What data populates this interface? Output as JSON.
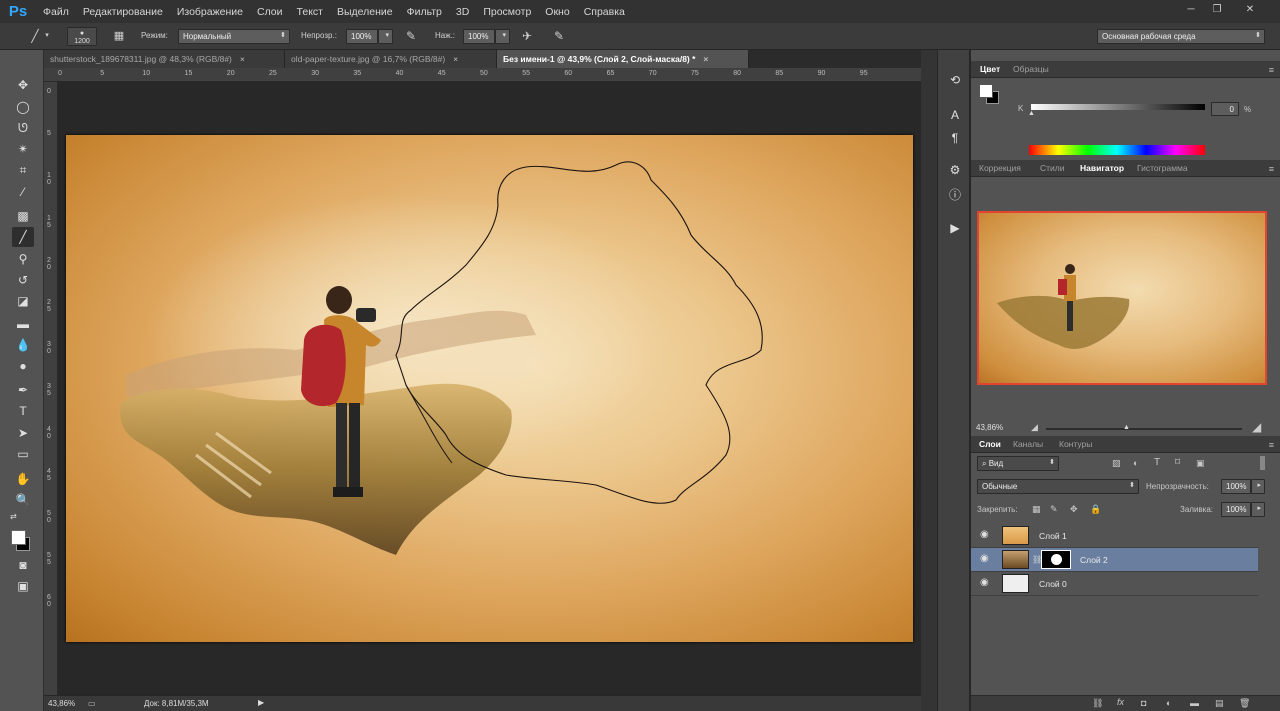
{
  "app": {
    "logo": "Ps"
  },
  "menu": [
    "Файл",
    "Редактирование",
    "Изображение",
    "Слои",
    "Текст",
    "Выделение",
    "Фильтр",
    "3D",
    "Просмотр",
    "Окно",
    "Справка"
  ],
  "options": {
    "brush_size": "1200",
    "mode_label": "Режим:",
    "mode_value": "Нормальный",
    "opacity_label": "Непрозр.:",
    "opacity_value": "100%",
    "pressure_label": "Наж.:",
    "pressure_value": "100%",
    "workspace": "Основная рабочая среда"
  },
  "tabs": [
    {
      "label": "shutterstock_189678311.jpg @ 48,3% (RGB/8#)",
      "close": "×"
    },
    {
      "label": "old-paper-texture.jpg @ 16,7% (RGB/8#)",
      "close": "×"
    },
    {
      "label": "Без имени-1 @ 43,9% (Слой 2, Слой-маска/8) *",
      "close": "×"
    }
  ],
  "ruler": {
    "h": [
      "0",
      "5",
      "10",
      "15",
      "20",
      "25",
      "30",
      "35",
      "40",
      "45",
      "50",
      "55",
      "60",
      "65",
      "70",
      "75",
      "80",
      "85",
      "90",
      "95"
    ],
    "v": [
      "0",
      "5",
      "1 0",
      "1 5",
      "2 0",
      "2 5",
      "3 0",
      "3 5",
      "4 0",
      "4 5",
      "5 0",
      "5 5",
      "6 0"
    ]
  },
  "status": {
    "zoom": "43,86%",
    "doc": "Док: 8,81M/35,3M"
  },
  "color_panel": {
    "tabs": [
      "Цвет",
      "Образцы"
    ],
    "k_label": "K",
    "k_value": "0",
    "k_unit": "%"
  },
  "navigator_panel": {
    "tabs": [
      "Коррекция",
      "Стили",
      "Навигатор",
      "Гистограмма"
    ],
    "zoom": "43,86%"
  },
  "layers_panel": {
    "tabs": [
      "Слои",
      "Каналы",
      "Контуры"
    ],
    "filter": "Вид",
    "blend": "Обычные",
    "opacity_label": "Непрозрачность:",
    "opacity_value": "100%",
    "lock_label": "Закрепить:",
    "fill_label": "Заливка:",
    "fill_value": "100%",
    "layers": [
      {
        "name": "Слой 1"
      },
      {
        "name": "Слой 2"
      },
      {
        "name": "Слой 0"
      }
    ]
  },
  "colors": {
    "accent": "#31a8ff",
    "selection": "#6a7f9f",
    "navigator_frame": "#e2442f"
  }
}
